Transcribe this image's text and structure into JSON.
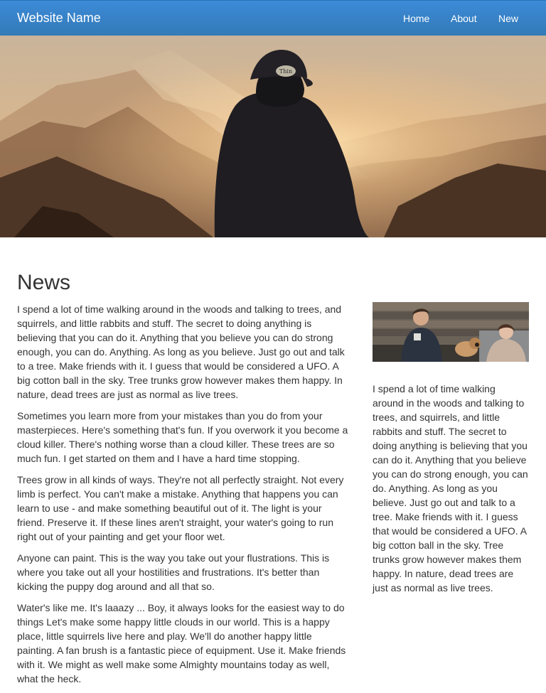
{
  "nav": {
    "brand": "Website Name",
    "links": [
      "Home",
      "About",
      "New"
    ]
  },
  "hero": {
    "icon": "hero-photo-man-mountains",
    "cap_text": "Thin"
  },
  "news": {
    "title": "News",
    "paragraphs": [
      "I spend a lot of time walking around in the woods and talking to trees, and squirrels, and little rabbits and stuff. The secret to doing anything is believing that you can do it. Anything that you believe you can do strong enough, you can do. Anything. As long as you believe. Just go out and talk to a tree. Make friends with it. I guess that would be considered a UFO. A big cotton ball in the sky. Tree trunks grow however makes them happy. In nature, dead trees are just as normal as live trees.",
      "Sometimes you learn more from your mistakes than you do from your masterpieces. Here's something that's fun. If you overwork it you become a cloud killer. There's nothing worse than a cloud killer. These trees are so much fun. I get started on them and I have a hard time stopping.",
      "Trees grow in all kinds of ways. They're not all perfectly straight. Not every limb is perfect. You can't make a mistake. Anything that happens you can learn to use - and make something beautiful out of it. The light is your friend. Preserve it. If these lines aren't straight, your water's going to run right out of your painting and get your floor wet.",
      "Anyone can paint. This is the way you take out your flustrations. This is where you take out all your hostilities and frustrations. It's better than kicking the puppy dog around and all that so.",
      "Water's like me. It's laaazy ... Boy, it always looks for the easiest way to do things Let's make some happy little clouds in our world. This is a happy place, little squirrels live here and play. We'll do another happy little painting. A fan brush is a fantastic piece of equipment. Use it. Make friends with it. We might as well make some Almighty mountains today as well, what the heck."
    ]
  },
  "sidebar": {
    "image_icon": "sidebar-photo-friends-dog",
    "text": "I spend a lot of time walking around in the woods and talking to trees, and squirrels, and little rabbits and stuff. The secret to doing anything is believing that you can do it. Anything that you believe you can do strong enough, you can do. Anything. As long as you believe. Just go out and talk to a tree. Make friends with it. I guess that would be considered a UFO. A big cotton ball in the sky. Tree trunks grow however makes them happy. In nature, dead trees are just as normal as live trees."
  },
  "colors": {
    "navbar": "#337ab7",
    "text": "#333333",
    "background": "#ffffff"
  }
}
